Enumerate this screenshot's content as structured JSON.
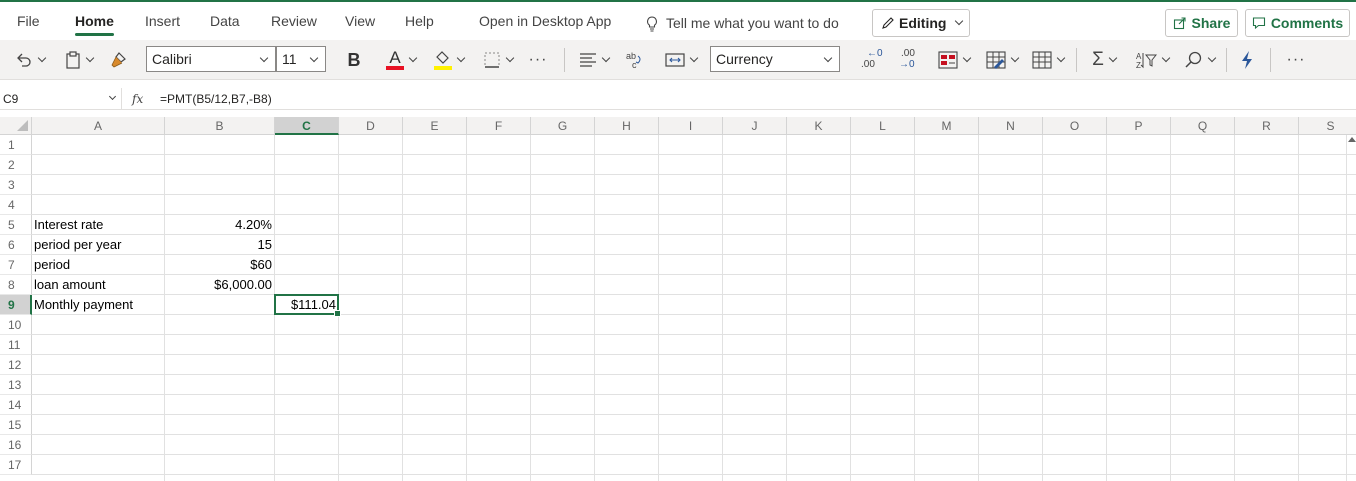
{
  "menu": {
    "items": [
      "File",
      "Home",
      "Insert",
      "Data",
      "Review",
      "View",
      "Help",
      "Open in Desktop App"
    ],
    "active": "Home",
    "tell_me": "Tell me what you want to do",
    "editing_label": "Editing",
    "share_label": "Share",
    "comments_label": "Comments"
  },
  "ribbon": {
    "font_name": "Calibri",
    "font_size": "11",
    "bold_label": "B",
    "font_color_label": "A",
    "number_format": "Currency",
    "decrease_decimal_label": ".00",
    "increase_decimal_label": ".00",
    "font_color": "#e81123",
    "highlight_color": "#fff100"
  },
  "formula_bar": {
    "name_box": "C9",
    "fx_label": "fx",
    "formula": "=PMT(B5/12,B7,-B8)"
  },
  "grid": {
    "columns": [
      "A",
      "B",
      "C",
      "D",
      "E",
      "F",
      "G",
      "H",
      "I",
      "J",
      "K",
      "L",
      "M",
      "N",
      "O",
      "P",
      "Q",
      "R",
      "S"
    ],
    "rows": [
      "1",
      "2",
      "3",
      "4",
      "5",
      "6",
      "7",
      "8",
      "9",
      "10",
      "11",
      "12",
      "13",
      "14",
      "15",
      "16",
      "17"
    ],
    "selected_column": "C",
    "selected_row": "9",
    "cells": {
      "A5": "Interest rate",
      "B5": "4.20%",
      "A6": "period per year",
      "B6": "15",
      "A7": "period",
      "B7": "$60",
      "A8": "loan amount",
      "B8": "$6,000.00",
      "A9": "Monthly payment",
      "C9": "$111.04"
    }
  },
  "colors": {
    "accent": "#217346"
  }
}
